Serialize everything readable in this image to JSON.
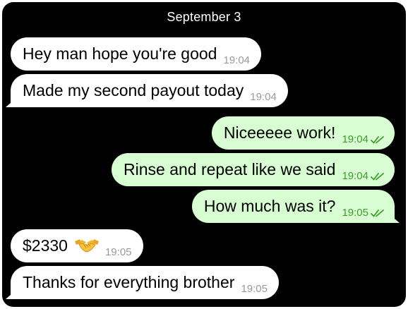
{
  "date_header": "September 3",
  "messages": [
    {
      "direction": "in",
      "text": "Hey man hope you're good",
      "time": "19:04"
    },
    {
      "direction": "in",
      "text": "Made my second payout today",
      "time": "19:04"
    },
    {
      "direction": "out",
      "text": "Niceeeee work!",
      "time": "19:04",
      "status_icon": "double-check-icon"
    },
    {
      "direction": "out",
      "text": "Rinse and repeat like we said",
      "time": "19:04",
      "status_icon": "double-check-icon"
    },
    {
      "direction": "out",
      "text": "How much was it?",
      "time": "19:05",
      "status_icon": "double-check-icon"
    },
    {
      "direction": "in",
      "text": "$2330",
      "emoji": "handshake-icon",
      "time": "19:05"
    },
    {
      "direction": "in",
      "text": "Thanks for everything brother",
      "time": "19:05"
    }
  ],
  "colors": {
    "background": "#000000",
    "incoming_bubble": "#ffffff",
    "outgoing_bubble": "#d9fdd3",
    "outgoing_meta": "#3f9d2a",
    "incoming_meta": "#9a9a9a"
  }
}
